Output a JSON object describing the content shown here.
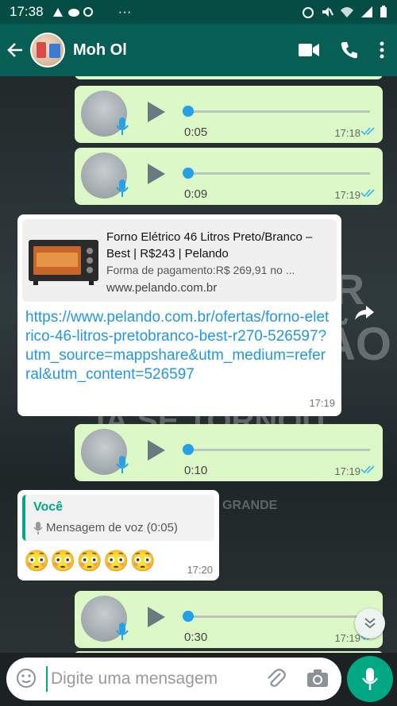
{
  "status": {
    "time": "17:38",
    "dots": "···"
  },
  "header": {
    "contact": "Moh Ol"
  },
  "background_text": [
    "R",
    "ÃO",
    "JÁ SE TORNOU",
    "GRANDE"
  ],
  "messages": {
    "voice1": {
      "duration": "0:05",
      "time": "17:18"
    },
    "voice2": {
      "duration": "0:09",
      "time": "17:19"
    },
    "link": {
      "title": "Forno Elétrico 46 Litros Preto/Branco – Best | R$243 | Pelando",
      "description": "Forma de pagamento:R$ 269,91 no ...",
      "domain": "www.pelando.com.br",
      "url": "https://www.pelando.com.br/ofertas/forno-eletrico-46-litros-pretobranco-best-r270-526597?utm_source=mappshare&utm_medium=referral&utm_content=526597",
      "time": "17:19"
    },
    "voice3": {
      "duration": "0:10",
      "time": "17:19"
    },
    "quoted": {
      "author": "Você",
      "quote_text": "Mensagem de voz (0:05)",
      "body": "😳😳😳😳😳",
      "time": "17:20"
    },
    "voice4": {
      "duration": "0:30",
      "time": "17:19"
    }
  },
  "input": {
    "placeholder": "Digite uma mensagem"
  },
  "colors": {
    "header": "#075e54",
    "outgoing": "#dcf8c6",
    "accent": "#00a884",
    "link": "#2297e3",
    "read_ticks": "#34b7f1"
  }
}
